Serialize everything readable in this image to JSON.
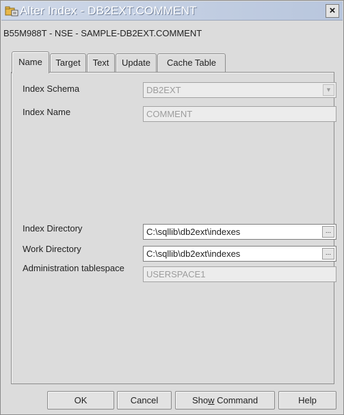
{
  "window": {
    "title": "Alter Index - DB2EXT.COMMENT",
    "subtitle": "B55M988T - NSE - SAMPLE-DB2EXT.COMMENT",
    "close_label": "×"
  },
  "tabs": [
    {
      "label": "Name",
      "active": true
    },
    {
      "label": "Target",
      "active": false
    },
    {
      "label": "Text",
      "active": false
    },
    {
      "label": "Update",
      "active": false
    },
    {
      "label": "Cache Table",
      "active": false
    }
  ],
  "form": {
    "index_schema": {
      "label": "Index Schema",
      "value": "DB2EXT",
      "enabled": false
    },
    "index_name": {
      "label": "Index Name",
      "value": "COMMENT",
      "enabled": false
    },
    "index_directory": {
      "label": "Index Directory",
      "value": "C:\\sqllib\\db2ext\\indexes",
      "browse_label": "..."
    },
    "work_directory": {
      "label": "Work Directory",
      "value": "C:\\sqllib\\db2ext\\indexes",
      "browse_label": "..."
    },
    "admin_tablespace": {
      "label": "Administration tablespace",
      "value": "USERSPACE1",
      "enabled": false
    }
  },
  "buttons": {
    "ok": "OK",
    "cancel": "Cancel",
    "show_command": {
      "prefix": "Sho",
      "mnemonic": "w",
      "suffix": " Command"
    },
    "help": "Help"
  },
  "colors": {
    "titlebar": "#b8c6dd",
    "dialog_bg": "#dcdcdc"
  },
  "icons": {
    "title": "folder-index-icon",
    "dropdown": "chevron-down-icon",
    "browse": "ellipsis-icon"
  }
}
